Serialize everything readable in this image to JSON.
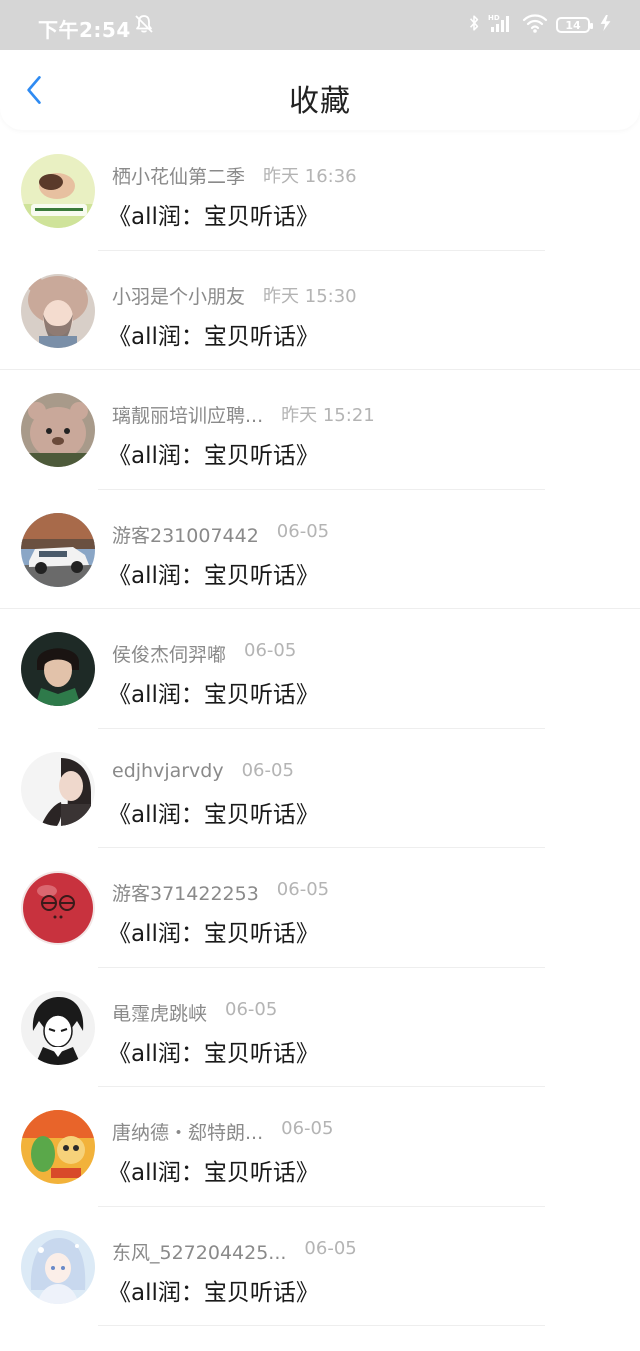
{
  "status_bar": {
    "time": "下午2:54",
    "battery": "14",
    "icons": [
      "mute-icon",
      "bluetooth-icon",
      "signal-hd-icon",
      "wifi-icon",
      "battery-icon",
      "charging-icon"
    ]
  },
  "header": {
    "title": "收藏",
    "back_icon": "chevron-left-icon",
    "accent_color": "#2f8bf2"
  },
  "favorites": [
    {
      "name": "栖小花仙第二季",
      "time": "昨天 16:36",
      "content": "《all润：宝贝听话》",
      "avatar": "avatar-baby"
    },
    {
      "name": "小羽是个小朋友",
      "time": "昨天 15:30",
      "content": "《all润：宝贝听话》",
      "avatar": "avatar-bear-hat-girl"
    },
    {
      "name": "璃靓丽培训应聘...",
      "time": "昨天 15:21",
      "content": "《all润：宝贝听话》",
      "avatar": "avatar-teddy-bear"
    },
    {
      "name": "游客231007442",
      "time": "06-05",
      "content": "《all润：宝贝听话》",
      "avatar": "avatar-car"
    },
    {
      "name": "侯俊杰伺羿嘟",
      "time": "06-05",
      "content": "《all润：宝贝听话》",
      "avatar": "avatar-man-scarf"
    },
    {
      "name": "edjhvjarvdy",
      "time": "06-05",
      "content": "《all润：宝贝听话》",
      "avatar": "avatar-woman"
    },
    {
      "name": "游客371422253",
      "time": "06-05",
      "content": "《all润：宝贝听话》",
      "avatar": "avatar-red-ball"
    },
    {
      "name": "黾霪虎跳峡",
      "time": "06-05",
      "content": "《all润：宝贝听话》",
      "avatar": "avatar-anime-sketch"
    },
    {
      "name": "唐纳德・郄特朗...",
      "time": "06-05",
      "content": "《all润：宝贝听话》",
      "avatar": "avatar-cartoon"
    },
    {
      "name": "东风_527204425...",
      "time": "06-05",
      "content": "《all润：宝贝听话》",
      "avatar": "avatar-anime-girl"
    }
  ]
}
